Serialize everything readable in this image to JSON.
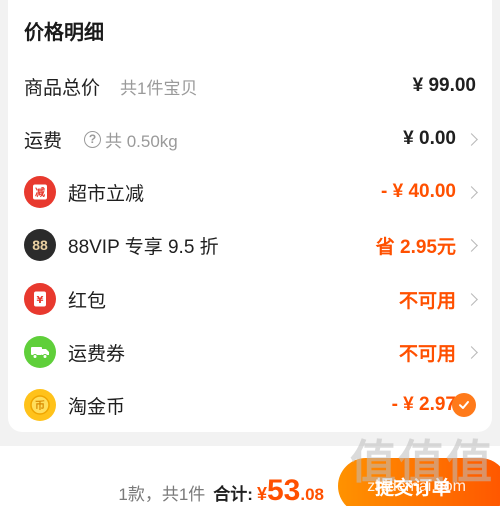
{
  "price_detail": {
    "title": "价格明细",
    "rows": [
      {
        "label": "商品总价",
        "sub": "共1件宝贝",
        "value": "¥ 99.00"
      },
      {
        "label": "运费",
        "sub": "共 0.50kg",
        "value": "¥ 0.00",
        "sub_icon": "question-circle-icon"
      },
      {
        "label": "超市立减",
        "value": "- ¥ 40.00",
        "icon": "supermarket-discount-icon",
        "icon_glyph": "减",
        "icon_color": "#e8392e"
      },
      {
        "label": "88VIP 专享 9.5 折",
        "value": "省 2.95元",
        "icon": "88vip-icon",
        "icon_glyph": "88",
        "icon_color": "#2b2b2b"
      },
      {
        "label": "红包",
        "value": "不可用",
        "icon": "red-packet-icon",
        "icon_glyph": "¥",
        "icon_color": "#e8392e"
      },
      {
        "label": "运费券",
        "value": "不可用",
        "icon": "shipping-coupon-icon",
        "icon_color": "#5fcf3a"
      },
      {
        "label": "淘金币",
        "value": "- ¥ 2.97",
        "icon": "taojinbi-coin-icon",
        "icon_glyph": "币",
        "icon_color": "#ffc21a",
        "checked": true
      }
    ]
  },
  "footer": {
    "count": "1款，共1件",
    "total_label": "合计:",
    "currency": "¥",
    "total_int": "53",
    "total_dec": ".08",
    "submit_label": "提交订单"
  },
  "watermark": {
    "text": "值值值",
    "url": "zhidemai.com"
  },
  "colors": {
    "accent": "#ff5000",
    "button_start": "#ff9200",
    "button_end": "#ff5500"
  }
}
